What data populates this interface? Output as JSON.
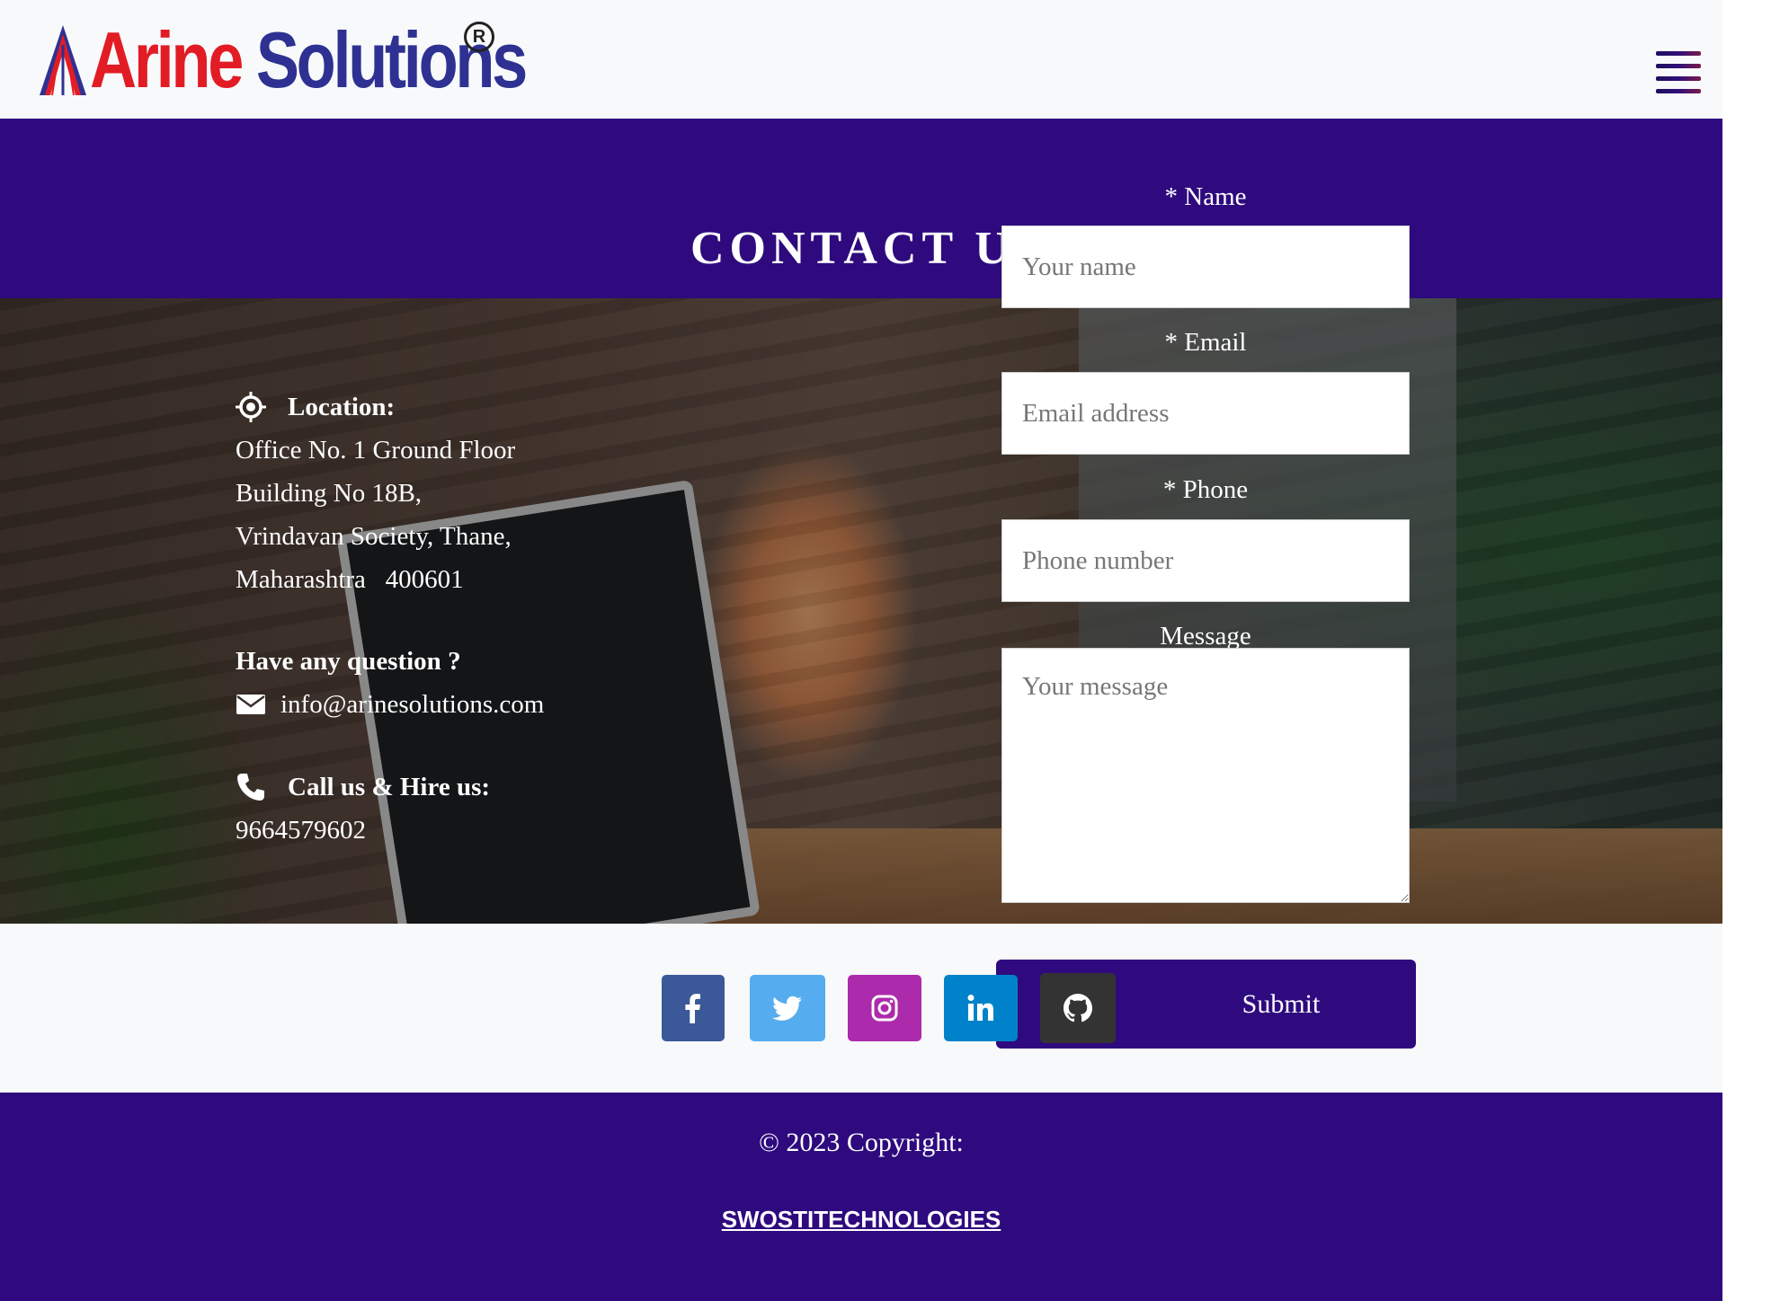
{
  "brand": {
    "name_part1": "Arine",
    "name_part2": "Solutions",
    "registered": "R"
  },
  "nav": {
    "menu_icon": "hamburger-menu-icon"
  },
  "page_title": "CONTACT US",
  "contact": {
    "location_heading": "Location:",
    "address_lines": [
      "Office No. 1 Ground Floor",
      "Building No 18B,",
      "Vrindavan Society, Thane,",
      "Maharashtra   400601"
    ],
    "question_heading": "Have any question ?",
    "email": "info@arinesolutions.com",
    "call_heading": "Call us & Hire us:",
    "phone": "9664579602"
  },
  "form": {
    "name_label": "* Name",
    "name_placeholder": "Your name",
    "email_label": "* Email",
    "email_placeholder": "Email address",
    "phone_label": "* Phone",
    "phone_placeholder": "Phone number",
    "message_label": "Message",
    "message_placeholder": "Your message",
    "submit_label": "Submit"
  },
  "social": [
    {
      "icon": "facebook-icon",
      "color": "#3b5998"
    },
    {
      "icon": "twitter-icon",
      "color": "#55acee"
    },
    {
      "icon": "instagram-icon",
      "color": "#ac2bac"
    },
    {
      "icon": "linkedin-icon",
      "color": "#0082ca"
    },
    {
      "icon": "github-icon",
      "color": "#333333"
    }
  ],
  "footer": {
    "copyright": "© 2023 Copyright:",
    "company_link": "SWOSTITECHNOLOGIES"
  },
  "colors": {
    "primary": "#2e0a7e",
    "brand_red": "#e21c24",
    "brand_blue": "#2e3192"
  }
}
